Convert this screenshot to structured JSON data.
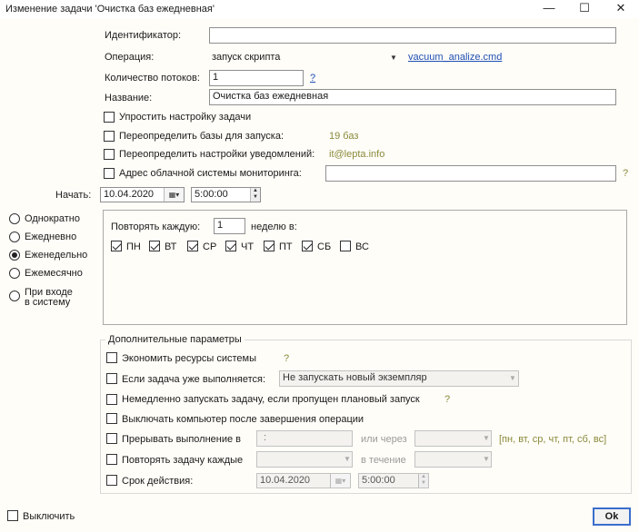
{
  "window": {
    "title": "Изменение задачи 'Очистка баз ежедневная'",
    "min_glyph": "—",
    "max_glyph": "☐",
    "close_glyph": "✕"
  },
  "form": {
    "identifier_label": "Идентификатор:",
    "identifier_value": "",
    "operation_label": "Операция:",
    "operation_value": "запуск скрипта",
    "operation_link": "vacuum_analize.cmd",
    "threads_label": "Количество потоков:",
    "threads_value": "1",
    "threads_help": "?",
    "name_label": "Название:",
    "name_value": "Очистка баз ежедневная",
    "simplify_label": "Упростить настройку задачи",
    "override_bases_label": "Переопределить базы для запуска:",
    "override_bases_value": "19 баз",
    "override_notify_label": "Переопределить настройки уведомлений:",
    "override_notify_value": "it@lepta.info",
    "cloud_label": "Адрес облачной системы мониторинга:",
    "cloud_value": "",
    "cloud_help": "?",
    "start_label": "Начать:",
    "start_date": "10.04.2020",
    "start_time": "5:00:00"
  },
  "schedule": {
    "options": [
      {
        "label": "Однократно",
        "selected": false
      },
      {
        "label": "Ежедневно",
        "selected": false
      },
      {
        "label": "Еженедельно",
        "selected": true
      },
      {
        "label": "Ежемесячно",
        "selected": false
      },
      {
        "label_line1": "При входе",
        "label_line2": "в систему",
        "selected": false
      }
    ],
    "repeat_label": "Повторять каждую:",
    "repeat_value": "1",
    "repeat_suffix": "неделю в:",
    "days": [
      {
        "label": "ПН",
        "checked": true
      },
      {
        "label": "ВТ",
        "checked": true
      },
      {
        "label": "СР",
        "checked": true
      },
      {
        "label": "ЧТ",
        "checked": true
      },
      {
        "label": "ПТ",
        "checked": true
      },
      {
        "label": "СБ",
        "checked": true
      },
      {
        "label": "ВС",
        "checked": false
      }
    ]
  },
  "extra": {
    "group_title": "Дополнительные параметры",
    "economize_label": "Экономить ресурсы системы",
    "economize_help": "?",
    "if_running_label": "Если задача уже выполняется:",
    "if_running_value": "Не запускать новый экземпляр",
    "run_missed_label": "Немедленно запускать задачу, если пропущен плановый запуск",
    "run_missed_help": "?",
    "shutdown_label": "Выключать компьютер после завершения операции",
    "interrupt_label": "Прерывать выполнение в",
    "interrupt_value": ":",
    "or_after_label": "или через",
    "interrupt_days": "[пн, вт, ср, чт, пт, сб, вс]",
    "repeat_every_label": "Повторять задачу каждые",
    "during_label": "в течение",
    "validity_label": "Срок действия:",
    "validity_date": "10.04.2020",
    "validity_time": "5:00:00"
  },
  "footer": {
    "disable_label": "Выключить",
    "ok_label": "Ok"
  }
}
